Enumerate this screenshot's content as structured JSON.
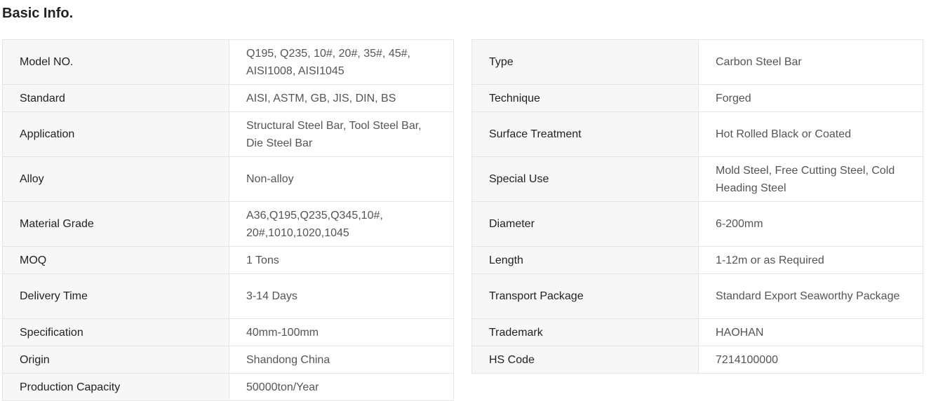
{
  "title": "Basic Info.",
  "left_rows": [
    {
      "key": "Model NO.",
      "value": "Q195, Q235, 10#, 20#, 35#, 45#, AISI1008, AISI1045"
    },
    {
      "key": "Standard",
      "value": "AISI, ASTM, GB, JIS, DIN, BS"
    },
    {
      "key": "Application",
      "value": "Structural Steel Bar, Tool Steel Bar, Die Steel Bar"
    },
    {
      "key": "Alloy",
      "value": "Non-alloy"
    },
    {
      "key": "Material Grade",
      "value": "A36,Q195,Q235,Q345,10#, 20#,1010,1020,1045"
    },
    {
      "key": "MOQ",
      "value": "1 Tons"
    },
    {
      "key": "Delivery Time",
      "value": "3-14 Days"
    },
    {
      "key": "Specification",
      "value": "40mm-100mm"
    },
    {
      "key": "Origin",
      "value": "Shandong China"
    },
    {
      "key": "Production Capacity",
      "value": "50000ton/Year"
    }
  ],
  "right_rows": [
    {
      "key": "Type",
      "value": "Carbon Steel Bar"
    },
    {
      "key": "Technique",
      "value": "Forged"
    },
    {
      "key": "Surface Treatment",
      "value": "Hot Rolled Black or Coated"
    },
    {
      "key": "Special Use",
      "value": "Mold Steel, Free Cutting Steel, Cold Heading Steel"
    },
    {
      "key": "Diameter",
      "value": "6-200mm"
    },
    {
      "key": "Length",
      "value": "1-12m or as Required"
    },
    {
      "key": "Transport Package",
      "value": "Standard Export Seaworthy Package"
    },
    {
      "key": "Trademark",
      "value": "HAOHAN"
    },
    {
      "key": "HS Code",
      "value": "7214100000"
    }
  ]
}
